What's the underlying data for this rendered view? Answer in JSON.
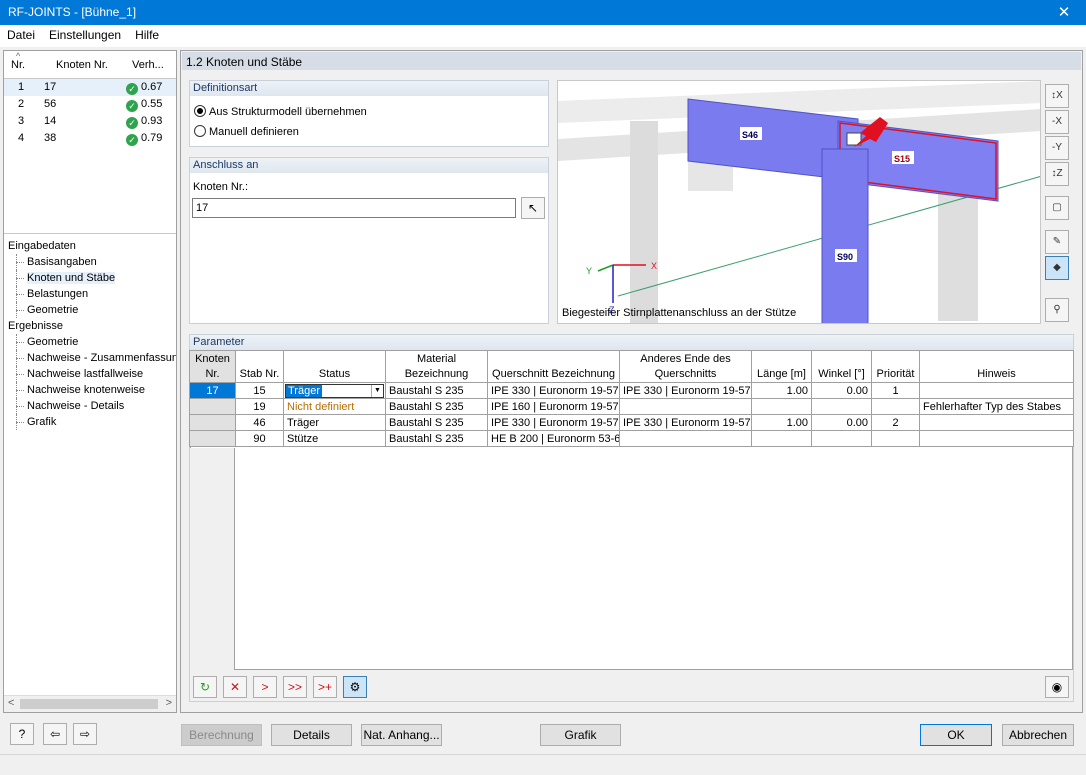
{
  "window": {
    "title": "RF-JOINTS - [Bühne_1]",
    "close": "✕"
  },
  "menu": [
    "Datei",
    "Einstellungen",
    "Hilfe"
  ],
  "left_table": {
    "headers": [
      "Nr.",
      "Knoten Nr.",
      "Verh..."
    ],
    "rows": [
      {
        "nr": "1",
        "knoten": "17",
        "verh": "0.67"
      },
      {
        "nr": "2",
        "knoten": "56",
        "verh": "0.55"
      },
      {
        "nr": "3",
        "knoten": "14",
        "verh": "0.93"
      },
      {
        "nr": "4",
        "knoten": "38",
        "verh": "0.79"
      }
    ]
  },
  "tree": {
    "eingabedaten": "Eingabedaten",
    "basisangaben": "Basisangaben",
    "knoten_staebe": "Knoten und Stäbe",
    "belastungen": "Belastungen",
    "geometrie1": "Geometrie",
    "ergebnisse": "Ergebnisse",
    "geometrie2": "Geometrie",
    "nw_zusammen": "Nachweise - Zusammenfassung",
    "nw_last": "Nachweise lastfallweise",
    "nw_knoten": "Nachweise knotenweise",
    "nw_details": "Nachweise - Details",
    "grafik": "Grafik"
  },
  "section_title": "1.2 Knoten und Stäbe",
  "definitionsart": {
    "title": "Definitionsart",
    "opt1": "Aus Strukturmodell übernehmen",
    "opt2": "Manuell definieren",
    "selected": "opt1"
  },
  "anschluss": {
    "title": "Anschluss an",
    "label": "Knoten Nr.:",
    "value": "17"
  },
  "graphic": {
    "caption": "Biegesteifer Stirnplattenanschluss an der Stütze",
    "labels": {
      "s46": "S46",
      "s15": "S15",
      "s90": "S90",
      "x": "X",
      "y": "Y",
      "z": "Z"
    }
  },
  "parameter": {
    "title": "Parameter",
    "headers": {
      "knoten": "Knoten Nr.",
      "stab": "Stab Nr.",
      "status": "Status",
      "material": "Material Bezeichnung",
      "querschnitt": "Querschnitt Bezeichnung",
      "anderes": "Anderes Ende des Querschnitts",
      "laenge": "Länge [m]",
      "winkel": "Winkel [°]",
      "prioritaet": "Priorität",
      "hinweis": "Hinweis"
    },
    "rows": [
      {
        "knoten": "17",
        "stab": "15",
        "status": "Träger",
        "material": "Baustahl S 235",
        "querschnitt": "IPE 330 | Euronorm 19-57",
        "anderes": "IPE 330 | Euronorm 19-57",
        "laenge": "1.00",
        "winkel": "0.00",
        "prioritaet": "1",
        "hinweis": ""
      },
      {
        "knoten": "",
        "stab": "19",
        "status": "Nicht definiert",
        "material": "Baustahl S 235",
        "querschnitt": "IPE 160 | Euronorm 19-57",
        "anderes": "",
        "laenge": "",
        "winkel": "",
        "prioritaet": "",
        "hinweis": "Fehlerhafter Typ des Stabes"
      },
      {
        "knoten": "",
        "stab": "46",
        "status": "Träger",
        "material": "Baustahl S 235",
        "querschnitt": "IPE 330 | Euronorm 19-57",
        "anderes": "IPE 330 | Euronorm 19-57",
        "laenge": "1.00",
        "winkel": "0.00",
        "prioritaet": "2",
        "hinweis": ""
      },
      {
        "knoten": "",
        "stab": "90",
        "status": "Stütze",
        "material": "Baustahl S 235",
        "querschnitt": "HE B 200 | Euronorm 53-6",
        "anderes": "",
        "laenge": "",
        "winkel": "",
        "prioritaet": "",
        "hinweis": ""
      }
    ]
  },
  "buttons": {
    "berechnung": "Berechnung",
    "details": "Details",
    "nat_anhang": "Nat. Anhang...",
    "grafik": "Grafik",
    "ok": "OK",
    "abbrechen": "Abbrechen"
  },
  "colors": {
    "accent": "#0078d7",
    "status_warn": "#b86e00",
    "beam": "#7b7bf0",
    "highlight": "#e01020"
  }
}
